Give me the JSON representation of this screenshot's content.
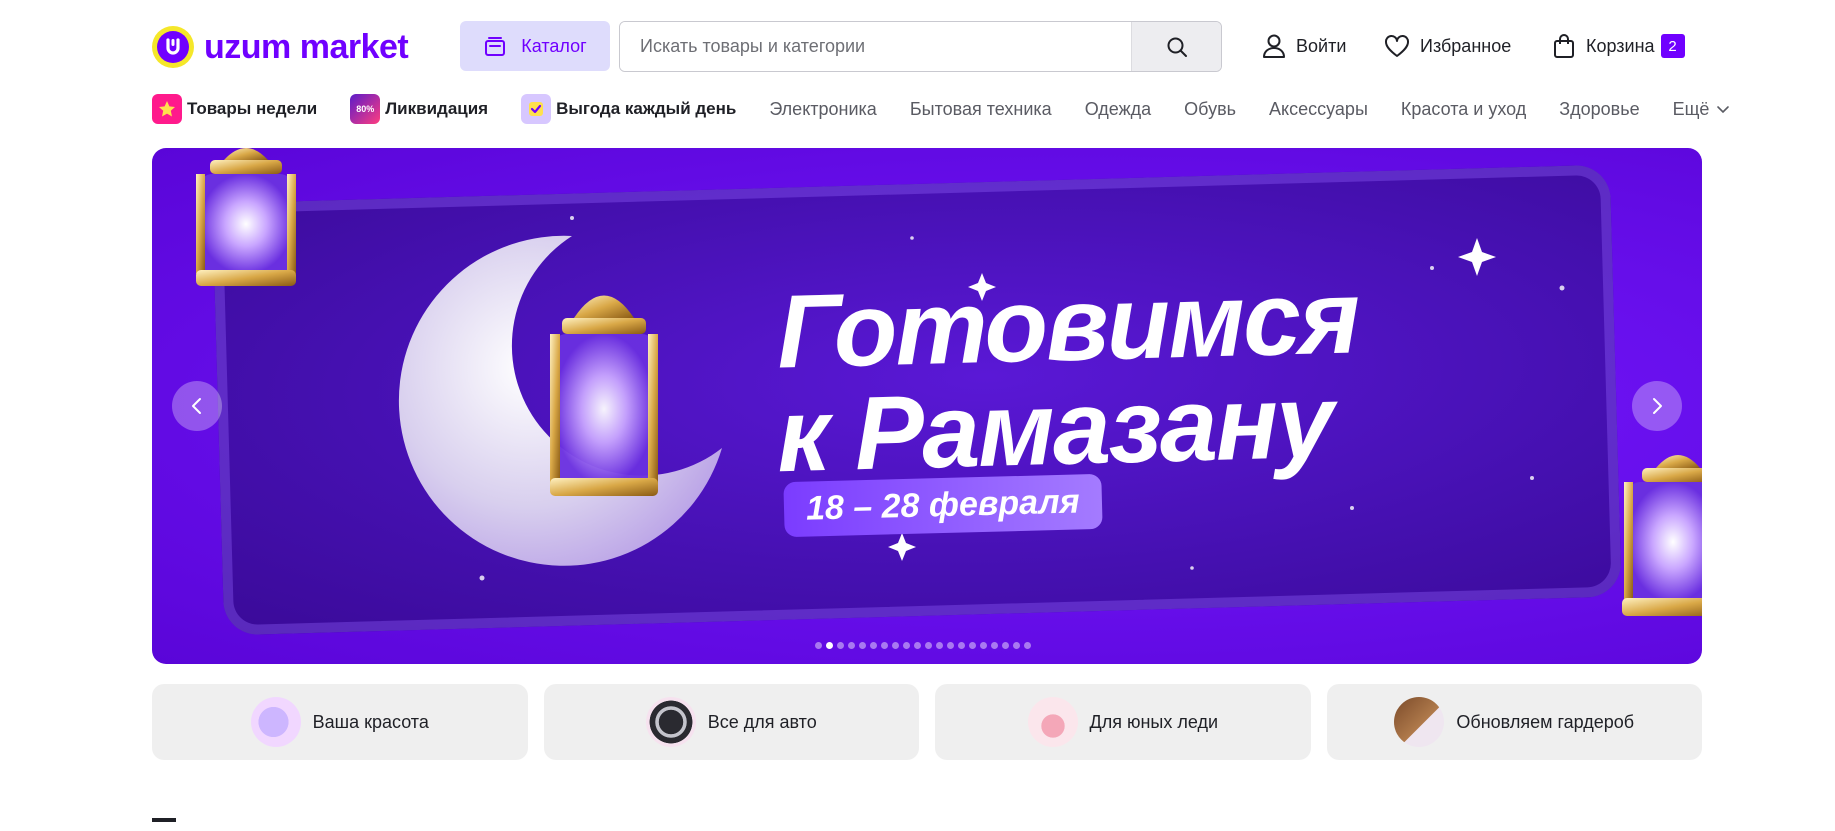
{
  "header": {
    "logo_text": "uzum market",
    "catalog_label": "Каталог",
    "search_placeholder": "Искать товары и категории",
    "login_label": "Войти",
    "favorites_label": "Избранное",
    "cart_label": "Корзина",
    "cart_count": "2"
  },
  "nav": {
    "items": [
      {
        "label": "Товары недели",
        "icon": "star-icon",
        "highlight": true
      },
      {
        "label": "Ликвидация",
        "icon": "sale-80-icon",
        "highlight": true,
        "icon_text": "80%"
      },
      {
        "label": "Выгода каждый день",
        "icon": "check-badge-icon",
        "highlight": true
      },
      {
        "label": "Электроника"
      },
      {
        "label": "Бытовая техника"
      },
      {
        "label": "Одежда"
      },
      {
        "label": "Обувь"
      },
      {
        "label": "Аксессуары"
      },
      {
        "label": "Красота и уход"
      },
      {
        "label": "Здоровье"
      }
    ],
    "more_label": "Ещё"
  },
  "banner": {
    "title_line1": "Готовимся",
    "title_line2": "к Рамазану",
    "dates": "18 – 28 февраля",
    "slide_count": 20,
    "active_slide": 2
  },
  "promos": [
    {
      "label": "Ваша красота",
      "icon": "mirror-cosmetics-icon"
    },
    {
      "label": "Все для авто",
      "icon": "car-wheel-icon"
    },
    {
      "label": "Для юных леди",
      "icon": "dress-icon"
    },
    {
      "label": "Обновляем гардероб",
      "icon": "coat-icon"
    }
  ],
  "colors": {
    "brand": "#7000ff",
    "logo_yellow": "#f5e72a",
    "catalog_bg": "#dedcfc",
    "promo_bg": "#efefef"
  }
}
